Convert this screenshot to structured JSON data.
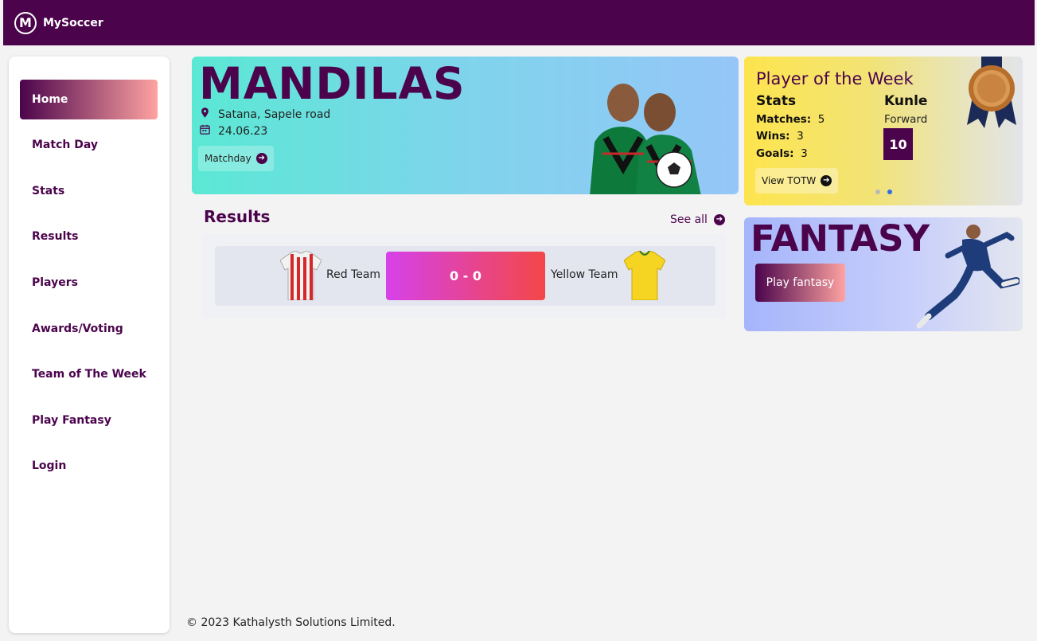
{
  "app": {
    "name": "MySoccer",
    "logo_letter": "M"
  },
  "sidebar": {
    "items": [
      {
        "label": "Home",
        "active": true
      },
      {
        "label": "Match Day",
        "active": false
      },
      {
        "label": "Stats",
        "active": false
      },
      {
        "label": "Results",
        "active": false
      },
      {
        "label": "Players",
        "active": false
      },
      {
        "label": "Awards/Voting",
        "active": false
      },
      {
        "label": "Team of The Week",
        "active": false
      },
      {
        "label": "Play Fantasy",
        "active": false
      },
      {
        "label": "Login",
        "active": false
      }
    ]
  },
  "banner": {
    "title": "MANDILAS",
    "location": "Satana, Sapele road",
    "date": "24.06.23",
    "button_label": "Matchday"
  },
  "results": {
    "title": "Results",
    "see_all_label": "See all",
    "match": {
      "home_team": "Red Team",
      "away_team": "Yellow Team",
      "score": "0 - 0",
      "home_color": "#d62828",
      "away_color": "#f5d422"
    }
  },
  "player_of_week": {
    "title": "Player of the Week",
    "stats_heading": "Stats",
    "stats": [
      {
        "label": "Matches:",
        "value": "5"
      },
      {
        "label": "Wins:",
        "value": "3"
      },
      {
        "label": "Goals:",
        "value": "3"
      }
    ],
    "player_name": "Kunle",
    "position": "Forward",
    "number": "10",
    "button_label": "View TOTW",
    "carousel_active_index": 1
  },
  "fantasy": {
    "title": "FANTASY",
    "button_label": "Play fantasy"
  },
  "footer": {
    "text": "© 2023 Kathalysth Solutions Limited."
  },
  "colors": {
    "brand": "#4b044c",
    "accent_pink": "#fea3a1",
    "score_gradient_start": "#d641ea",
    "score_gradient_end": "#f34747"
  }
}
